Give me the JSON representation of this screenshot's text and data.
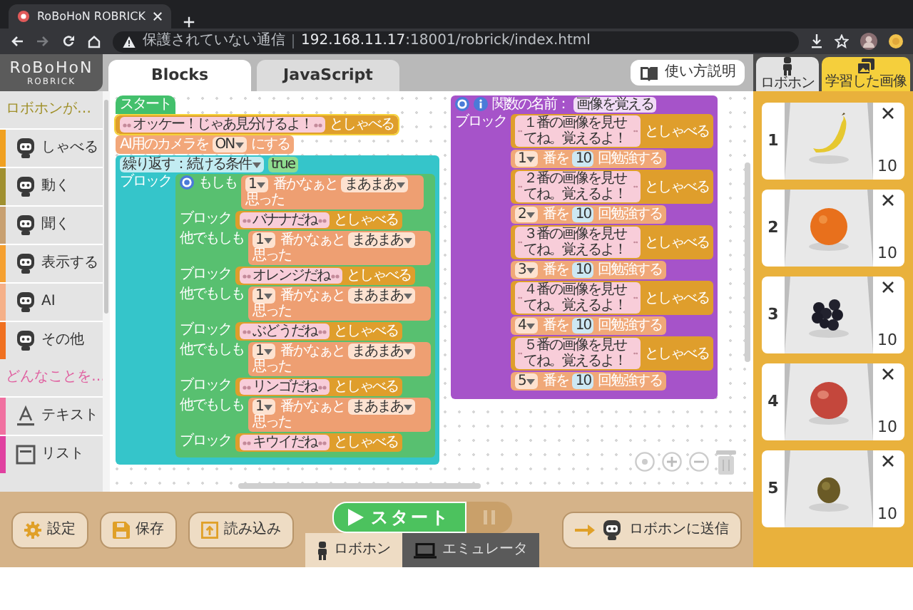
{
  "browser": {
    "tab_title": "RoBoHoN ROBRICK",
    "security": "保護されていない通信",
    "url": "**192.168.11.17**:18001/robrick/index.html"
  },
  "app_header": {
    "logo": "RoBoHoN",
    "logo_sub": "ROBRICK",
    "tabs": [
      {
        "label": "Blocks",
        "selected": true
      },
      {
        "label": "JavaScript",
        "selected": false
      }
    ],
    "help_button": "使い方説明"
  },
  "sidebar": {
    "sections": [
      {
        "heading": "ロボホンが…",
        "color": "#a0902a",
        "items": [
          {
            "label": "しゃべる",
            "kind": "robot",
            "color": "#f0a020"
          },
          {
            "label": "動く",
            "kind": "robot",
            "color": "#a09030"
          },
          {
            "label": "聞く",
            "kind": "robot",
            "color": "#c8a070"
          },
          {
            "label": "表示する",
            "kind": "robot",
            "color": "#f5a030"
          },
          {
            "label": "AI",
            "kind": "robot",
            "color": "#f5b088"
          },
          {
            "label": "その他",
            "kind": "robot",
            "color": "#f07020"
          }
        ]
      },
      {
        "heading": "どんなことを…",
        "color": "#e060a0",
        "items": [
          {
            "label": "テキスト",
            "kind": "text",
            "color": "#f070a0"
          },
          {
            "label": "リスト",
            "kind": "list",
            "color": "#e040a0"
          }
        ]
      }
    ]
  },
  "workspace": {
    "script": {
      "hat": "スタート",
      "say": {
        "text": "オッケー！じゃあ見分けるよ！",
        "suffix": "としゃべる"
      },
      "camera": {
        "prefix": "AI用のカメラを",
        "value": "ON",
        "suffix": "にする"
      },
      "loop": {
        "label": "繰り返す：続ける条件",
        "condition": "true",
        "body_label": "ブロック",
        "branches": [
          {
            "keyword": "もしも",
            "number": "1",
            "middle": "番かなぁと",
            "certainty": "まあまあ",
            "end": "思った",
            "body_label": "ブロック",
            "say": {
              "text": "バナナだね",
              "suffix": "としゃべる"
            }
          },
          {
            "keyword": "他でもしも",
            "number": "1",
            "middle": "番かなぁと",
            "certainty": "まあまあ",
            "end": "思った",
            "body_label": "ブロック",
            "say": {
              "text": "オレンジだね",
              "suffix": "としゃべる"
            }
          },
          {
            "keyword": "他でもしも",
            "number": "1",
            "middle": "番かなぁと",
            "certainty": "まあまあ",
            "end": "思った",
            "body_label": "ブロック",
            "say": {
              "text": "ぶどうだね",
              "suffix": "としゃべる"
            }
          },
          {
            "keyword": "他でもしも",
            "number": "1",
            "middle": "番かなぁと",
            "certainty": "まあまあ",
            "end": "思った",
            "body_label": "ブロック",
            "say": {
              "text": "リンゴだね",
              "suffix": "としゃべる"
            }
          },
          {
            "keyword": "他でもしも",
            "number": "1",
            "middle": "番かなぁと",
            "certainty": "まあまあ",
            "end": "思った",
            "body_label": "ブロック",
            "say": {
              "text": "キウイだね",
              "suffix": "としゃべる"
            }
          }
        ]
      }
    },
    "function": {
      "title": "関数の名前：",
      "name": "画像を覚える",
      "body_label": "ブロック",
      "steps": [
        {
          "say": {
            "text": "１番の画像を見せてね。覚えるよ！",
            "suffix": "としゃべる"
          },
          "number": "1",
          "middle": "番を",
          "count": "10",
          "end": "回勉強する"
        },
        {
          "say": {
            "text": "２番の画像を見せてね。覚えるよ！",
            "suffix": "としゃべる"
          },
          "number": "2",
          "middle": "番を",
          "count": "10",
          "end": "回勉強する"
        },
        {
          "say": {
            "text": "３番の画像を見せてね。覚えるよ！",
            "suffix": "としゃべる"
          },
          "number": "3",
          "middle": "番を",
          "count": "10",
          "end": "回勉強する"
        },
        {
          "say": {
            "text": "４番の画像を見せてね。覚えるよ！",
            "suffix": "としゃべる"
          },
          "number": "4",
          "middle": "番を",
          "count": "10",
          "end": "回勉強する"
        },
        {
          "say": {
            "text": "５番の画像を見せてね。覚えるよ！",
            "suffix": "としゃべる"
          },
          "number": "5",
          "middle": "番を",
          "count": "10",
          "end": "回勉強する"
        }
      ]
    }
  },
  "right_panel": {
    "tabs": [
      {
        "label": "ロボホン",
        "kind": "robot",
        "selected": false
      },
      {
        "label": "学習した画像",
        "kind": "images",
        "selected": true
      }
    ],
    "images": [
      {
        "number": "1",
        "count": "10"
      },
      {
        "number": "2",
        "count": "10"
      },
      {
        "number": "3",
        "count": "10"
      },
      {
        "number": "4",
        "count": "10"
      },
      {
        "number": "5",
        "count": "10"
      }
    ]
  },
  "toolbar": {
    "buttons": [
      {
        "kind": "settings",
        "label": "設定"
      },
      {
        "kind": "save",
        "label": "保存"
      },
      {
        "kind": "load",
        "label": "読み込み"
      }
    ],
    "start": "スタート",
    "targets": [
      {
        "kind": "robot",
        "label": "ロボホン",
        "selected": true
      },
      {
        "kind": "emulator",
        "label": "エミュレータ",
        "selected": false
      }
    ],
    "send": "ロボホンに送信"
  }
}
